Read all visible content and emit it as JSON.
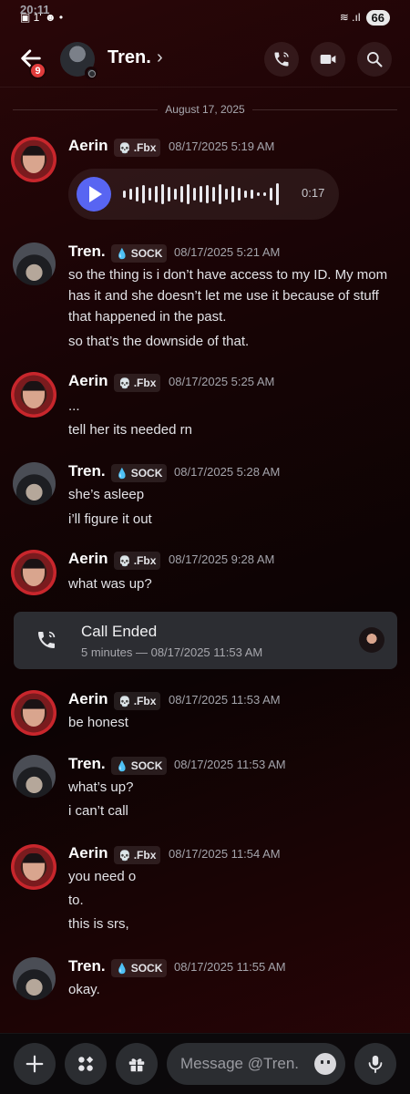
{
  "status_bar": {
    "time": "20:11",
    "icons": "▣ 1' ☻ •",
    "signal": "≋ .ıl",
    "battery": "66"
  },
  "header": {
    "back_badge": "9",
    "contact_name": "Tren.",
    "chevron": "›"
  },
  "date_divider": "August 17, 2025",
  "messages": [
    {
      "author": "Aerin",
      "tag": ".Fbx",
      "tag_icon": "💀",
      "time": "08/17/2025 5:19 AM",
      "lines": [],
      "voice_duration": "0:17"
    },
    {
      "author": "Tren.",
      "tag": "SOCK",
      "tag_icon": "💧",
      "time": "08/17/2025 5:21 AM",
      "lines": [
        "so the thing is i don’t have access to my ID. My mom has it and she doesn’t let me use it because of stuff that happened in the past.",
        "so that’s the downside of that."
      ]
    },
    {
      "author": "Aerin",
      "tag": ".Fbx",
      "tag_icon": "💀",
      "time": "08/17/2025 5:25 AM",
      "lines": [
        "...",
        "tell her its needed rn"
      ]
    },
    {
      "author": "Tren.",
      "tag": "SOCK",
      "tag_icon": "💧",
      "time": "08/17/2025 5:28 AM",
      "lines": [
        "she’s asleep",
        "i’ll figure it out"
      ]
    },
    {
      "author": "Aerin",
      "tag": ".Fbx",
      "tag_icon": "💀",
      "time": "08/17/2025 9:28 AM",
      "lines": [
        "what was up?"
      ]
    },
    {
      "author": "Aerin",
      "tag": ".Fbx",
      "tag_icon": "💀",
      "time": "08/17/2025 11:53 AM",
      "lines": [
        "be honest"
      ]
    },
    {
      "author": "Tren.",
      "tag": "SOCK",
      "tag_icon": "💧",
      "time": "08/17/2025 11:53 AM",
      "lines": [
        "what’s up?",
        "i can’t call"
      ]
    },
    {
      "author": "Aerin",
      "tag": ".Fbx",
      "tag_icon": "💀",
      "time": "08/17/2025 11:54 AM",
      "lines": [
        "you need o",
        "to.",
        "this is srs,"
      ]
    },
    {
      "author": "Tren.",
      "tag": "SOCK",
      "tag_icon": "💧",
      "time": "08/17/2025 11:55 AM",
      "lines": [
        "okay."
      ]
    }
  ],
  "call": {
    "title": "Call Ended",
    "subtitle": "5 minutes — 08/17/2025 11:53 AM"
  },
  "input": {
    "placeholder": "Message @Tren."
  },
  "colors": {
    "accent": "#5865f2",
    "badge": "#e03b3b",
    "background_tint": "#2a0608"
  }
}
